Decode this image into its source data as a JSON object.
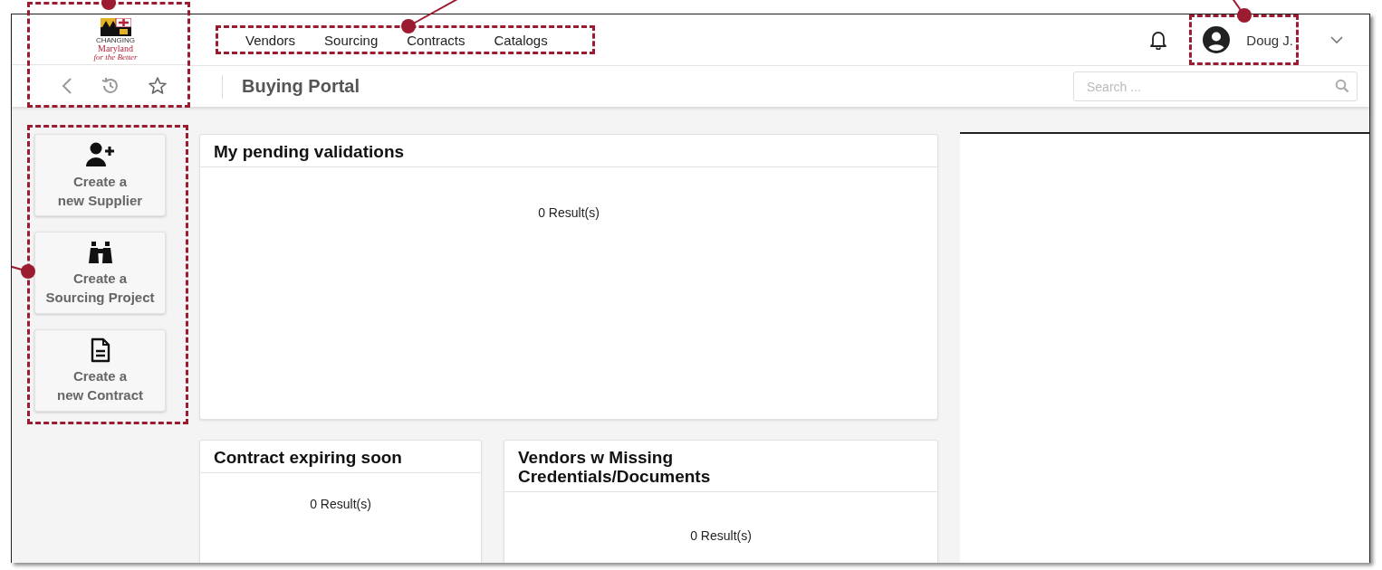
{
  "branding": {
    "logo_lines": [
      "CHANGING",
      "Maryland",
      "for the Better"
    ],
    "callout": {
      "kind": "up"
    }
  },
  "main_menu": {
    "items": [
      {
        "label": "Vendors"
      },
      {
        "label": "Sourcing"
      },
      {
        "label": "Contracts"
      },
      {
        "label": "Catalogs"
      }
    ],
    "callout": {
      "kind": "up-right"
    }
  },
  "user": {
    "name": "Doug J.",
    "callout": {
      "kind": "up-left"
    }
  },
  "page_title": "Buying Portal",
  "search": {
    "placeholder": "Search ..."
  },
  "quick_actions": {
    "items": [
      {
        "kind": "supplier",
        "label": "Create a\nnew Supplier"
      },
      {
        "kind": "sourcing",
        "label": "Create a\nSourcing Project"
      },
      {
        "kind": "contract",
        "label": "Create a\nnew Contract"
      }
    ],
    "callout": {
      "kind": "left"
    }
  },
  "widgets": [
    {
      "title": "My pending validations",
      "result": "0 Result(s)",
      "kind": "full"
    },
    {
      "title": "Contract expiring soon",
      "result": "0 Result(s)",
      "kind": "narrow"
    },
    {
      "title": "Vendors w Missing Credentials/Documents",
      "result": "0 Result(s)",
      "kind": "wide"
    }
  ]
}
